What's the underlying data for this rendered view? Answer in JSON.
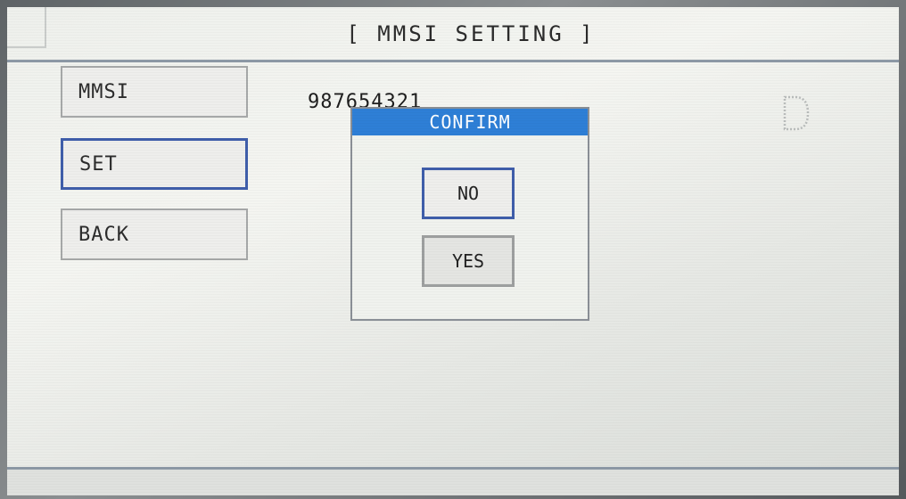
{
  "header": {
    "title": "[ MMSI SETTING ]"
  },
  "menu": {
    "items": [
      {
        "label": "MMSI"
      },
      {
        "label": "SET"
      },
      {
        "label": "BACK"
      }
    ]
  },
  "mmsi": {
    "value": "987654321"
  },
  "dialog": {
    "title": "CONFIRM",
    "no_label": "NO",
    "yes_label": "YES"
  },
  "colors": {
    "dialog_title_bg": "#2e7fd6",
    "selection_border": "#3f5eaa",
    "divider": "#8d99a6"
  },
  "icons": {
    "status_indicator": "letter-d-dotted-icon"
  }
}
